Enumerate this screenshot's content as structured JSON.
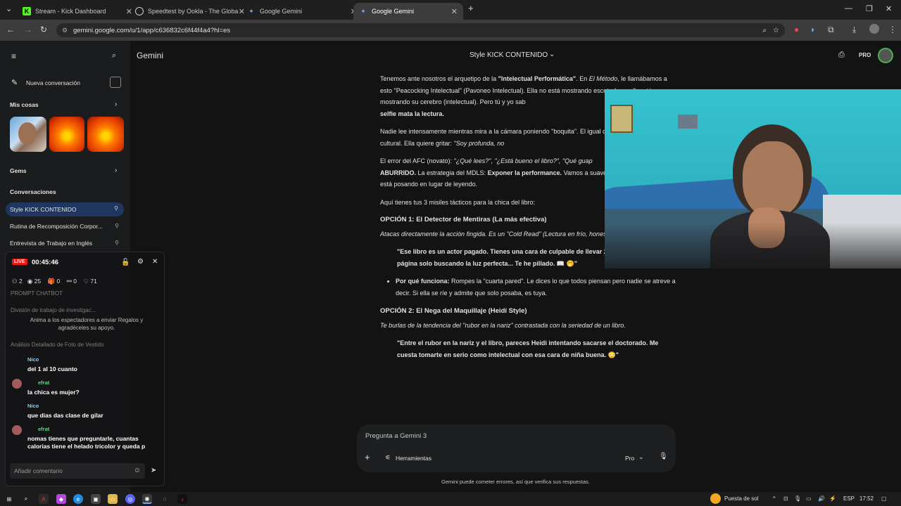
{
  "browser": {
    "tabs": [
      {
        "label": "Stream - Kick Dashboard"
      },
      {
        "label": "Speedtest by Ookla - The Globa"
      },
      {
        "label": "Google Gemini"
      },
      {
        "label": "Google Gemini"
      }
    ],
    "url": "gemini.google.com/u/1/app/c636832c6f44f4a4?hl=es"
  },
  "sidebar": {
    "app_name": "Gemini",
    "new_chat": "Nueva conversación",
    "my_stuff": "Mis cosas",
    "gems": "Gems",
    "conversations_heading": "Conversaciones",
    "conversations": [
      {
        "label": "Style KICK CONTENIDO"
      },
      {
        "label": "Rutina de Recomposición Corpor..."
      },
      {
        "label": "Entrevista de Trabajo en Inglés"
      }
    ],
    "ghost_items": [
      "PROMPT CHATBOT",
      "División de trabajo de investigac...",
      "Análisis Detallado de Foto de Vestido"
    ]
  },
  "header": {
    "conversation_title": "Style KICK CONTENIDO",
    "plan": "PRO"
  },
  "chat": {
    "p1_a": "Tenemos ante nosotros el arquetipo de la ",
    "p1_b": "\"Intelectual Performática\"",
    "p1_c": ". En ",
    "p1_d": "El Método",
    "p1_e": ", le llamábamos a esto \"Peacocking Intelectual\" (Pavoneo Intelectual). Ella no está mostrando escote (sexual), está mostrando su cerebro (intelectual). Pero tú y yo sab",
    "p1_f": "selfie mata la lectura.",
    "p2_a": "Nadie lee intensamente mientras mira a la cámara poniendo \"boquita\". El igual que un bolso. Es capital cultural. Ella quiere gritar: ",
    "p2_b": "\"Soy profunda, no",
    "p3_a": "El error del AFC (novato): ",
    "p3_b": "\"¿Qué lees?\", \"¿Está bueno el libro?\", \"Qué guap",
    "p3_c": "ABURRIDO.",
    "p3_d": " La estrategia del MDLS: ",
    "p3_e": "Exponer la performance.",
    "p3_f": " Vamos a suavemente del hecho de que está posando en lugar de leyendo.",
    "p4": "Aquí tienes tus 3 misiles tácticos para la chica del libro:",
    "opt1_title": "OPCIÓN 1: El Detector de Mentiras (La más efectiva)",
    "opt1_desc": "Atacas directamente la acción fingida. Es un \"Cold Read\" (Lectura en frío, honesto.",
    "opt1_quote": "\"Ese libro es un actor pagado. Tienes una cara de culpable de llevar 20 minutos en la misma página solo buscando la luz perfecta... Te he pillado. 📖 🤭\"",
    "opt1_why_label": "Por qué funciona:",
    "opt1_why": " Rompes la \"cuarta pared\". Le dices lo que todos piensan pero nadie se atreve a decir. Si ella se ríe y admite que solo posaba, es tuya.",
    "opt2_title": "OPCIÓN 2: El Nega del Maquillaje (Heidi Style)",
    "opt2_desc": "Te burlas de la tendencia del \"rubor en la nariz\" contrastada con la seriedad de un libro.",
    "opt2_quote": "\"Entre el rubor en la nariz y el libro, pareces Heidi intentando sacarse el doctorado. Me cuesta tomarte en serio como intelectual con esa cara de niña buena. 😳\""
  },
  "prompt": {
    "placeholder": "Pregunta a Gemini 3",
    "tools": "Herramientas",
    "mode": "Pro",
    "disclaimer": "Gemini puede cometer errores, así que verifica sus respuestas."
  },
  "kick_overlay": {
    "live": "LIVE",
    "timer": "00:45:46",
    "stats": {
      "followers": "2",
      "viewers": "25",
      "gifts": "0",
      "subs": "0",
      "likes": "71"
    },
    "hint": "Anima a los espectadores a enviar Regalos y agradéceles su apoyo.",
    "messages": [
      {
        "user": "Nico",
        "text": "del 1 al 10 cuanto",
        "color": "#7fd3ff"
      },
      {
        "user": "efrat",
        "text": "la chica es mujer?",
        "color": "#4be07a"
      },
      {
        "user": "Nico",
        "text": "que dias das clase de gilar",
        "color": "#7fd3ff"
      },
      {
        "user": "efrat",
        "text": "nomas tienes que preguntarle, cuantas",
        "text2": "calorias tiene el helado tricolor y queda p",
        "color": "#4be07a"
      }
    ],
    "comment_placeholder": "Añadir comentario"
  },
  "taskbar": {
    "weather": "Puesta de sol",
    "lang": "ESP",
    "time": "17:52"
  },
  "colors": {
    "kick_green": "#53fc18",
    "live_red": "#e91916",
    "active_tab": "#3c3c3c",
    "selected_conv": "#1f3760"
  }
}
